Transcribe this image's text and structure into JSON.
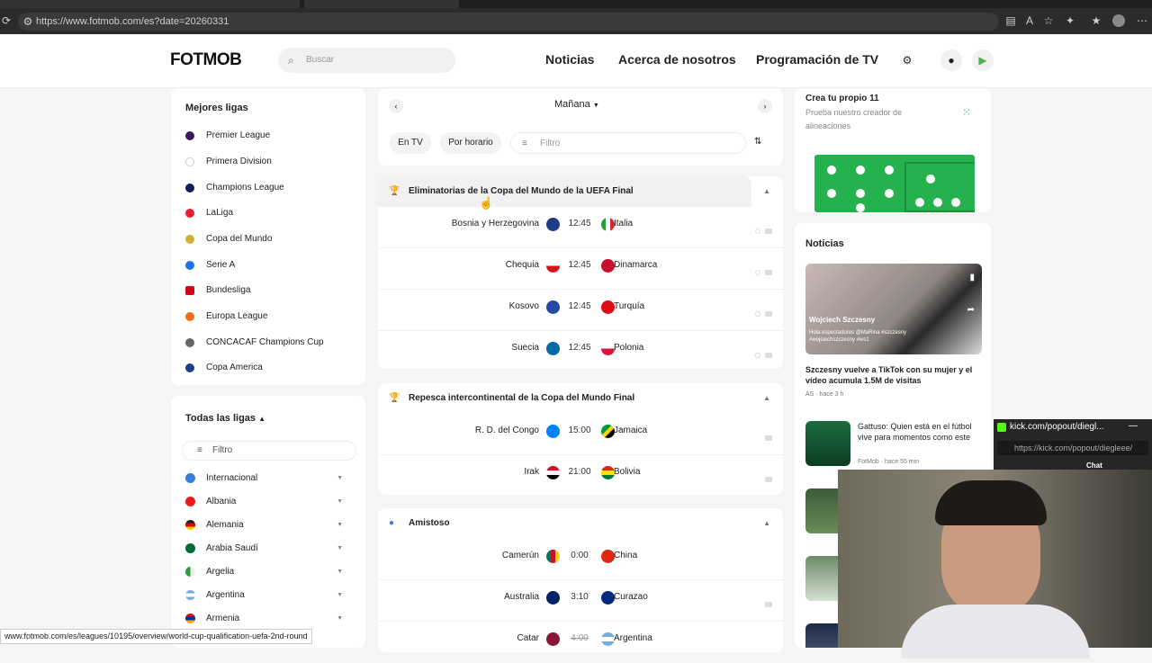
{
  "browser": {
    "url": "https://www.fotmob.com/es?date=20260331"
  },
  "header": {
    "logo": "FOTMOB",
    "search_placeholder": "Buscar",
    "nav": [
      "Noticias",
      "Acerca de nosotros",
      "Programación de TV"
    ]
  },
  "left": {
    "top_leagues_title": "Mejores ligas",
    "leagues": [
      {
        "name": "Premier League",
        "color": "#3d195b"
      },
      {
        "name": "Primera Division",
        "color": "#dddddd"
      },
      {
        "name": "Champions League",
        "color": "#0e1e5b"
      },
      {
        "name": "LaLiga",
        "color": "#e8202a"
      },
      {
        "name": "Copa del Mundo",
        "color": "#d4af37"
      },
      {
        "name": "Serie A",
        "color": "#1a73e8"
      },
      {
        "name": "Bundesliga",
        "color": "#d20515"
      },
      {
        "name": "Europa League",
        "color": "#f26b21"
      },
      {
        "name": "CONCACAF Champions Cup",
        "color": "#666666"
      },
      {
        "name": "Copa America",
        "color": "#1d3f8f"
      }
    ],
    "all_leagues_title": "Todas las ligas",
    "filter_placeholder": "Filtro",
    "countries": [
      {
        "name": "Internacional",
        "color": "#3b7ddd"
      },
      {
        "name": "Albania",
        "color": "#e41e20"
      },
      {
        "name": "Alemania",
        "color": "#222222"
      },
      {
        "name": "Arabia Saudí",
        "color": "#006c35"
      },
      {
        "name": "Argelia",
        "color": "#2a9d3a"
      },
      {
        "name": "Argentina",
        "color": "#74acdf"
      },
      {
        "name": "Armenia",
        "color": "#d90012"
      }
    ]
  },
  "center": {
    "day": "Mañana",
    "buttons": [
      "En TV",
      "Por horario"
    ],
    "filter_placeholder": "Filtro",
    "groups": [
      {
        "title": "Eliminatorias de la Copa del Mundo de la UEFA Final",
        "icon": "trophy-icon",
        "matches": [
          {
            "home": "Bosnia y Herzegovina",
            "time": "12:45",
            "away": "Italia",
            "home_color": "#1f3c88",
            "away_color": "#2e9a3f"
          },
          {
            "home": "Chequia",
            "time": "12:45",
            "away": "Dinamarca",
            "home_color": "#d7141a",
            "away_color": "#c8102e"
          },
          {
            "home": "Kosovo",
            "time": "12:45",
            "away": "Turquía",
            "home_color": "#244aa5",
            "away_color": "#e30a17"
          },
          {
            "home": "Suecia",
            "time": "12:45",
            "away": "Polonia",
            "home_color": "#006aa7",
            "away_color": "#dc143c"
          }
        ]
      },
      {
        "title": "Repesca intercontinental de la Copa del Mundo Final",
        "icon": "trophy-icon",
        "matches": [
          {
            "home": "R. D. del Congo",
            "time": "15:00",
            "away": "Jamaica",
            "home_color": "#007fff",
            "away_color": "#009b3a"
          },
          {
            "home": "Irak",
            "time": "21:00",
            "away": "Bolivia",
            "home_color": "#ce1126",
            "away_color": "#d52b1e"
          }
        ]
      },
      {
        "title": "Amistoso",
        "icon": "globe-icon",
        "matches": [
          {
            "home": "Camerún",
            "time": "0:00",
            "away": "China",
            "home_color": "#007a5e",
            "away_color": "#de2910"
          },
          {
            "home": "Australia",
            "time": "3:10",
            "away": "Curazao",
            "home_color": "#012169",
            "away_color": "#002b7f"
          },
          {
            "home": "Catar",
            "time": "4:00",
            "away": "Argentina",
            "home_color": "#8a1538",
            "away_color": "#74acdf"
          }
        ]
      }
    ]
  },
  "right": {
    "lineup_title": "Crea tu propio 11",
    "lineup_sub": "Prueba nuestro creador de alineaciones",
    "news_title": "Noticias",
    "feature_overlay_name": "Wojciech Szczesny",
    "feature_overlay_text": "Hola espectadores @MaRina #szczesny #wojciechszczesny #ws1",
    "feature_title": "Szczesny vuelve a TikTok con su mujer y el vídeo acumula 1.5M de visitas",
    "feature_meta": "AS · hace 3 h",
    "news_list": [
      {
        "title": "Gattuso: Quien está en el fútbol vive para momentos como este",
        "meta": "FotMob · hace 55 min"
      }
    ]
  },
  "popout": {
    "title": "kick.com/popout/diegl...",
    "url": "https://kick.com/popout/diegleee/",
    "label": "Chat"
  },
  "statusbar": "www.fotmob.com/es/leagues/10195/overview/world-cup-qualification-uefa-2nd-round"
}
